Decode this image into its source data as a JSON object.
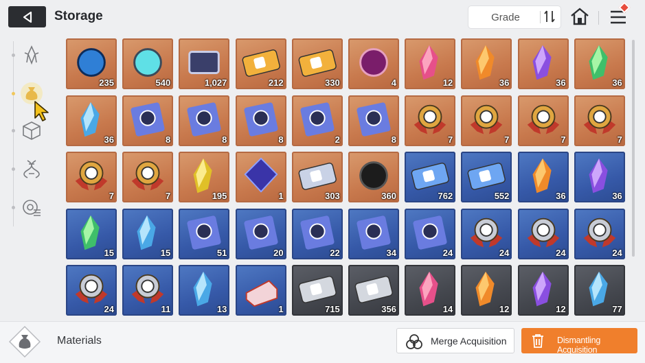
{
  "header": {
    "title": "Storage",
    "sort_label": "Grade"
  },
  "sidebar": {
    "items": [
      {
        "icon": "crystal-icon"
      },
      {
        "icon": "pouch-icon",
        "active": true
      },
      {
        "icon": "cube-icon"
      },
      {
        "icon": "dna-icon"
      },
      {
        "icon": "chip-icon"
      }
    ]
  },
  "grid": {
    "rows": [
      [
        {
          "icon": "blue-creature-icon",
          "rarity": "orange",
          "count": "235"
        },
        {
          "icon": "orb-capsule-icon",
          "rarity": "orange",
          "count": "540"
        },
        {
          "icon": "data-chip-icon",
          "rarity": "orange",
          "count": "1,027"
        },
        {
          "icon": "gold-ticket-icon",
          "rarity": "orange",
          "count": "212"
        },
        {
          "icon": "gold-pass-icon",
          "rarity": "orange",
          "count": "330"
        },
        {
          "icon": "eye-core-icon",
          "rarity": "orange",
          "count": "4"
        },
        {
          "icon": "pink-crystal-icon",
          "rarity": "orange",
          "count": "12"
        },
        {
          "icon": "orange-crystal-icon",
          "rarity": "orange",
          "count": "36"
        },
        {
          "icon": "purple-crystal-icon",
          "rarity": "orange",
          "count": "36"
        },
        {
          "icon": "green-crystal-icon",
          "rarity": "orange",
          "count": "36"
        }
      ],
      [
        {
          "icon": "blue-crystal-icon",
          "rarity": "orange",
          "count": "36"
        },
        {
          "icon": "skill-book-sword-icon",
          "rarity": "orange",
          "count": "8"
        },
        {
          "icon": "skill-book-shield-icon",
          "rarity": "orange",
          "count": "8"
        },
        {
          "icon": "skill-book-target-icon",
          "rarity": "orange",
          "count": "8"
        },
        {
          "icon": "skill-book-cross-icon",
          "rarity": "orange",
          "count": "2"
        },
        {
          "icon": "skill-book-blade-icon",
          "rarity": "orange",
          "count": "8"
        },
        {
          "icon": "gold-medal-sword-icon",
          "rarity": "orange",
          "count": "7"
        },
        {
          "icon": "gold-medal-shield-icon",
          "rarity": "orange",
          "count": "7"
        },
        {
          "icon": "gold-medal-target-icon",
          "rarity": "orange",
          "count": "7"
        },
        {
          "icon": "gold-medal-cross-icon",
          "rarity": "orange",
          "count": "7"
        }
      ],
      [
        {
          "icon": "gold-medal-compass-icon",
          "rarity": "orange",
          "count": "7"
        },
        {
          "icon": "gold-medal-globe-icon",
          "rarity": "orange",
          "count": "7"
        },
        {
          "icon": "yellow-shards-icon",
          "rarity": "orange",
          "count": "195"
        },
        {
          "icon": "dark-cube-icon",
          "rarity": "orange",
          "count": "1"
        },
        {
          "icon": "music-scroll-icon",
          "rarity": "orange",
          "count": "303"
        },
        {
          "icon": "black-urchin-icon",
          "rarity": "orange",
          "count": "360"
        },
        {
          "icon": "blue-ticket-icon",
          "rarity": "blue",
          "count": "762"
        },
        {
          "icon": "blue-pass-icon",
          "rarity": "blue",
          "count": "552"
        },
        {
          "icon": "orange-crystal-icon",
          "rarity": "blue",
          "count": "36"
        },
        {
          "icon": "purple-crystal-icon",
          "rarity": "blue",
          "count": "36"
        }
      ],
      [
        {
          "icon": "green-crystal-icon",
          "rarity": "blue",
          "count": "15"
        },
        {
          "icon": "blue-crystal-icon",
          "rarity": "blue",
          "count": "15"
        },
        {
          "icon": "skill-book-sword-icon",
          "rarity": "blue",
          "count": "51"
        },
        {
          "icon": "skill-book-shield-icon",
          "rarity": "blue",
          "count": "20"
        },
        {
          "icon": "skill-book-target-icon",
          "rarity": "blue",
          "count": "22"
        },
        {
          "icon": "skill-book-cross-icon",
          "rarity": "blue",
          "count": "34"
        },
        {
          "icon": "skill-book-blade-icon",
          "rarity": "blue",
          "count": "24"
        },
        {
          "icon": "silver-medal-sword-icon",
          "rarity": "blue",
          "count": "24"
        },
        {
          "icon": "silver-medal-shield-icon",
          "rarity": "blue",
          "count": "24"
        },
        {
          "icon": "silver-medal-target-icon",
          "rarity": "blue",
          "count": "24"
        }
      ],
      [
        {
          "icon": "silver-medal-compass-icon",
          "rarity": "blue",
          "count": "24"
        },
        {
          "icon": "silver-medal-globe-icon",
          "rarity": "blue",
          "count": "11"
        },
        {
          "icon": "blue-shards-icon",
          "rarity": "blue",
          "count": "13"
        },
        {
          "icon": "cake-icon",
          "rarity": "blue",
          "count": "1"
        },
        {
          "icon": "silver-ticket-icon",
          "rarity": "gray",
          "count": "715"
        },
        {
          "icon": "silver-pass-icon",
          "rarity": "gray",
          "count": "356"
        },
        {
          "icon": "pink-crystal-icon",
          "rarity": "gray",
          "count": "14"
        },
        {
          "icon": "orange-crystal-icon",
          "rarity": "gray",
          "count": "12"
        },
        {
          "icon": "purple-crystal-icon",
          "rarity": "gray",
          "count": "12"
        },
        {
          "icon": "blue-crystal-icon",
          "rarity": "gray",
          "count": "77"
        }
      ]
    ]
  },
  "footer": {
    "category_label": "Materials",
    "merge_label": "Merge Acquisition",
    "dismantle_label": "Dismantling Acquisition"
  },
  "colors": {
    "accent": "#f07f2c",
    "rarity_orange": "#c8794d",
    "rarity_blue": "#3659a8",
    "rarity_gray": "#44474e"
  }
}
